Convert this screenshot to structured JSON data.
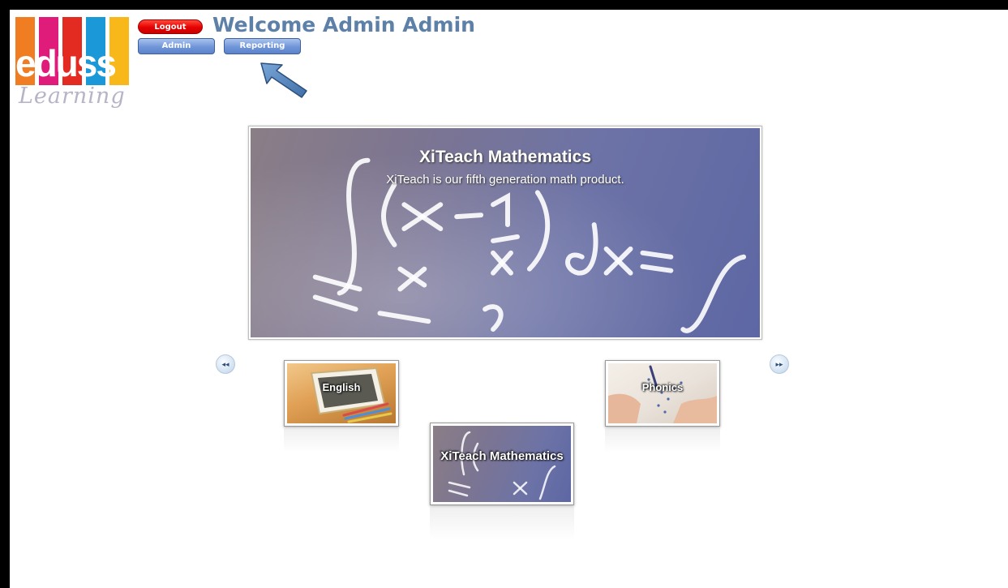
{
  "logo": {
    "word": "eduss",
    "script": "Learning",
    "bar_colors": [
      "#f07d22",
      "#e01c7a",
      "#e42b22",
      "#1a98d8",
      "#f8b81a"
    ]
  },
  "header": {
    "logout_label": "Logout",
    "admin_label": "Admin",
    "reporting_label": "Reporting",
    "welcome_text": "Welcome Admin Admin"
  },
  "banner": {
    "title": "XiTeach Mathematics",
    "subtitle": "XiTeach is our fifth generation math product."
  },
  "carousel": {
    "items": [
      {
        "label": "English"
      },
      {
        "label": "XiTeach Mathematics"
      },
      {
        "label": "Phonics"
      }
    ],
    "prev_symbol": "◂◂",
    "next_symbol": "▸▸"
  },
  "colors": {
    "welcome": "#5d80a8",
    "logout": "#e50000",
    "blue_button": "#7095d8"
  }
}
